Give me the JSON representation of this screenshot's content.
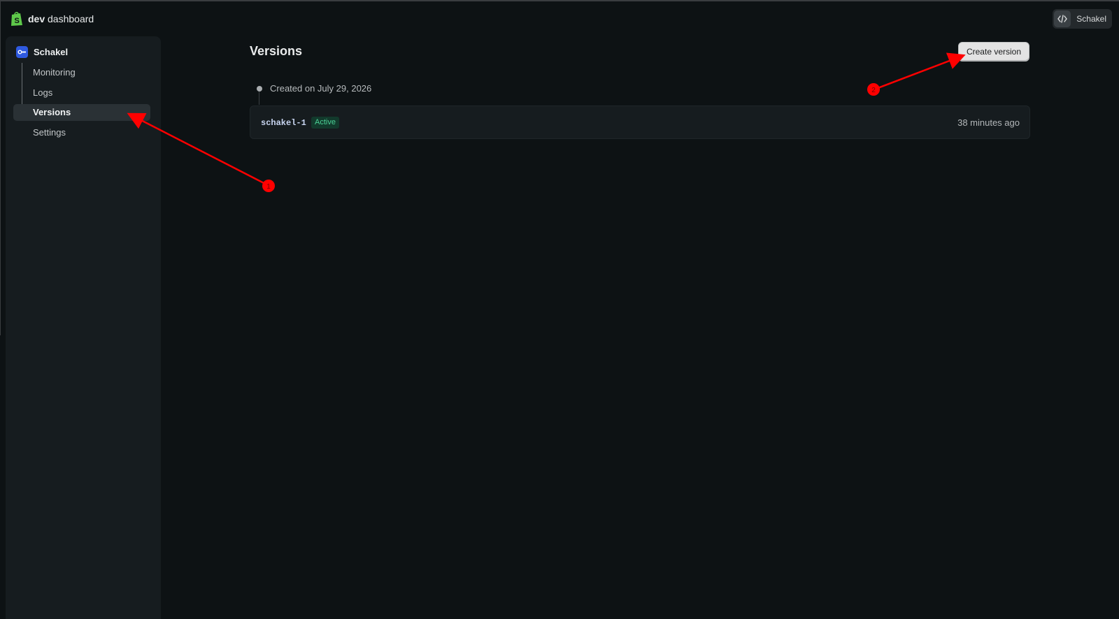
{
  "header": {
    "logo_bold": "dev",
    "logo_rest": " dashboard",
    "user_name": "Schakel",
    "icons": {
      "logo": "shopify-bag-icon",
      "user": "code-icon"
    }
  },
  "sidebar": {
    "app_name": "Schakel",
    "app_icon": "app-key-icon",
    "items": [
      {
        "label": "Monitoring",
        "active": false
      },
      {
        "label": "Logs",
        "active": false
      },
      {
        "label": "Versions",
        "active": true
      },
      {
        "label": "Settings",
        "active": false
      }
    ]
  },
  "main": {
    "title": "Versions",
    "create_button": "Create version",
    "timeline_label": "Created on July 29, 2026",
    "versions": [
      {
        "name": "schakel-1",
        "status": "Active",
        "time": "38 minutes ago"
      }
    ]
  },
  "annotations": [
    {
      "number": "1"
    },
    {
      "number": "2"
    }
  ],
  "colors": {
    "background": "#0d1214",
    "sidebar": "#161c1f",
    "accent_blue": "#2f5ae0",
    "status_green": "#4cd196",
    "annotation_red": "#ff0000"
  }
}
